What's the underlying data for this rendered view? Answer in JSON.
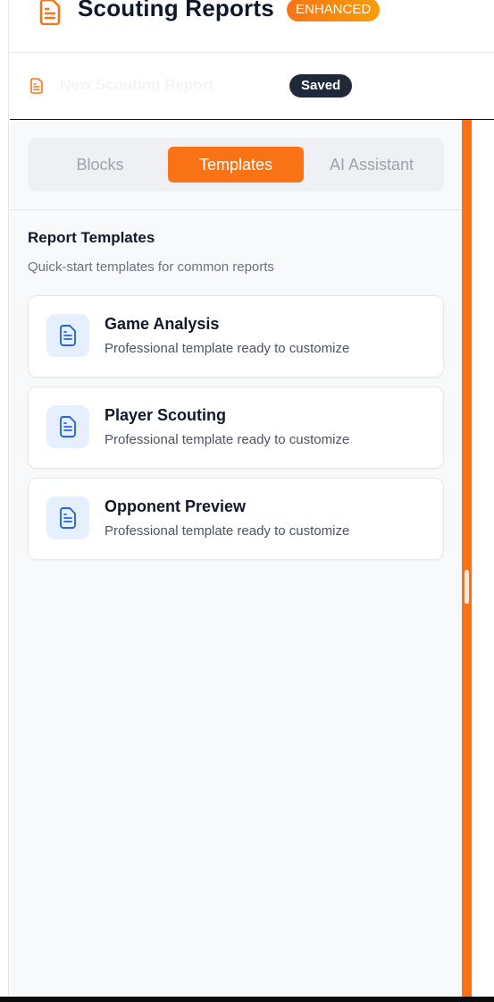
{
  "header": {
    "title": "Scouting Reports",
    "badge": "ENHANCED",
    "accent_color": "#f97316"
  },
  "report": {
    "title": "New Scouting Report",
    "status": "Saved"
  },
  "tabs": [
    {
      "label": "Blocks",
      "active": false
    },
    {
      "label": "Templates",
      "active": true
    },
    {
      "label": "AI Assistant",
      "active": false
    }
  ],
  "templates_section": {
    "title": "Report Templates",
    "subtitle": "Quick-start templates for common reports",
    "items": [
      {
        "name": "Game Analysis",
        "description": "Professional template ready to customize",
        "icon": "document-icon"
      },
      {
        "name": "Player Scouting",
        "description": "Professional template ready to customize",
        "icon": "document-icon"
      },
      {
        "name": "Opponent Preview",
        "description": "Professional template ready to customize",
        "icon": "document-icon"
      }
    ]
  }
}
